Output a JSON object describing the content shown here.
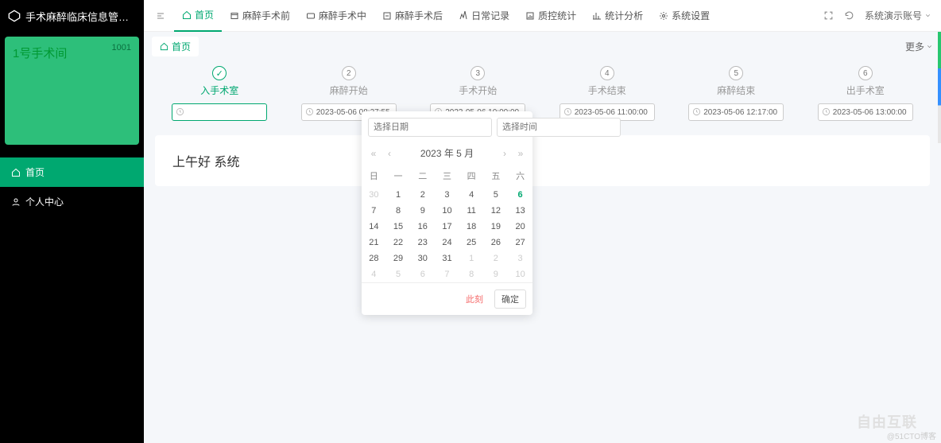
{
  "app": {
    "title": "手术麻醉临床信息管…"
  },
  "room": {
    "name": "1号手术间",
    "number": "1001"
  },
  "side_nav": [
    {
      "key": "home",
      "label": "首页",
      "active": true
    },
    {
      "key": "user",
      "label": "个人中心",
      "active": false
    }
  ],
  "top_tabs": [
    {
      "key": "home",
      "label": "首页",
      "active": true
    },
    {
      "key": "pre",
      "label": "麻醉手术前",
      "active": false
    },
    {
      "key": "intra",
      "label": "麻醉手术中",
      "active": false
    },
    {
      "key": "post",
      "label": "麻醉手术后",
      "active": false
    },
    {
      "key": "daily",
      "label": "日常记录",
      "active": false
    },
    {
      "key": "qc",
      "label": "质控统计",
      "active": false
    },
    {
      "key": "stats",
      "label": "统计分析",
      "active": false
    },
    {
      "key": "sys",
      "label": "系统设置",
      "active": false
    }
  ],
  "account_label": "系统演示账号",
  "subtab": {
    "label": "首页"
  },
  "more_label": "更多",
  "steps": [
    {
      "title": "入手术室",
      "value": "",
      "done": true
    },
    {
      "title": "麻醉开始",
      "value": "2023-05-06 08:27:55",
      "done": false
    },
    {
      "title": "手术开始",
      "value": "2023-05-06 10:00:00",
      "done": false
    },
    {
      "title": "手术结束",
      "value": "2023-05-06 11:00:00",
      "done": false
    },
    {
      "title": "麻醉结束",
      "value": "2023-05-06 12:17:00",
      "done": false
    },
    {
      "title": "出手术室",
      "value": "2023-05-06 13:00:00",
      "done": false
    }
  ],
  "greeting": "上午好 系统",
  "datepicker": {
    "date_placeholder": "选择日期",
    "time_placeholder": "选择时间",
    "year_month": "2023 年  5 月",
    "weekdays": [
      "日",
      "一",
      "二",
      "三",
      "四",
      "五",
      "六"
    ],
    "rows": [
      [
        {
          "d": "30",
          "dim": true
        },
        {
          "d": "1"
        },
        {
          "d": "2"
        },
        {
          "d": "3"
        },
        {
          "d": "4"
        },
        {
          "d": "5"
        },
        {
          "d": "6",
          "today": true
        }
      ],
      [
        {
          "d": "7"
        },
        {
          "d": "8"
        },
        {
          "d": "9"
        },
        {
          "d": "10"
        },
        {
          "d": "11"
        },
        {
          "d": "12"
        },
        {
          "d": "13"
        }
      ],
      [
        {
          "d": "14"
        },
        {
          "d": "15"
        },
        {
          "d": "16"
        },
        {
          "d": "17"
        },
        {
          "d": "18"
        },
        {
          "d": "19"
        },
        {
          "d": "20"
        }
      ],
      [
        {
          "d": "21"
        },
        {
          "d": "22"
        },
        {
          "d": "23"
        },
        {
          "d": "24"
        },
        {
          "d": "25"
        },
        {
          "d": "26"
        },
        {
          "d": "27"
        }
      ],
      [
        {
          "d": "28"
        },
        {
          "d": "29"
        },
        {
          "d": "30"
        },
        {
          "d": "31"
        },
        {
          "d": "1",
          "dim": true
        },
        {
          "d": "2",
          "dim": true
        },
        {
          "d": "3",
          "dim": true
        }
      ],
      [
        {
          "d": "4",
          "dim": true
        },
        {
          "d": "5",
          "dim": true
        },
        {
          "d": "6",
          "dim": true
        },
        {
          "d": "7",
          "dim": true
        },
        {
          "d": "8",
          "dim": true
        },
        {
          "d": "9",
          "dim": true
        },
        {
          "d": "10",
          "dim": true
        }
      ]
    ],
    "now_label": "此刻",
    "ok_label": "确定"
  },
  "watermark": "@51CTO博客",
  "watermark2": "自由互联"
}
